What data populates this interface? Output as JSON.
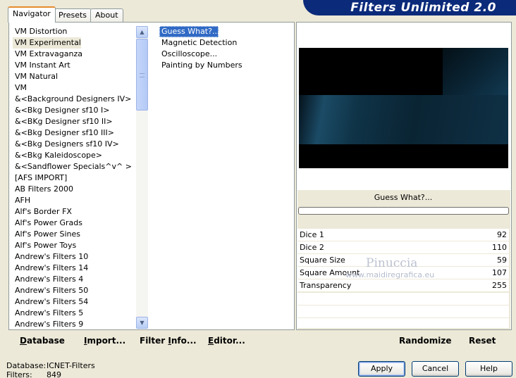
{
  "header": {
    "title": "Filters Unlimited 2.0"
  },
  "tabs": [
    {
      "label": "Navigator",
      "active": true
    },
    {
      "label": "Presets",
      "active": false
    },
    {
      "label": "About",
      "active": false
    }
  ],
  "categories": {
    "selected_index": 1,
    "items": [
      "VM Distortion",
      "VM Experimental",
      "VM Extravaganza",
      "VM Instant Art",
      "VM Natural",
      "VM",
      "&<Background Designers IV>",
      "&<Bkg Designer sf10 I>",
      "&<BKg Designer sf10 II>",
      "&<Bkg Designer sf10 III>",
      "&<Bkg Designers sf10 IV>",
      "&<Bkg Kaleidoscope>",
      "&<Sandflower Specials^v^ >",
      "[AFS IMPORT]",
      "AB Filters 2000",
      "AFH",
      "Alf's Border FX",
      "Alf's Power Grads",
      "Alf's Power Sines",
      "Alf's Power Toys",
      "Andrew's Filters 10",
      "Andrew's Filters 14",
      "Andrew's Filters 4",
      "Andrew's Filters 50",
      "Andrew's Filters 54",
      "Andrew's Filters 5",
      "Andrew's Filters 9"
    ]
  },
  "filters": {
    "selected_index": 0,
    "items": [
      "Guess What?...",
      "Magnetic Detection",
      "Oscilloscope...",
      "Painting by Numbers"
    ]
  },
  "preview": {
    "filter_name": "Guess What?...",
    "progress": 0
  },
  "params": [
    {
      "label": "Dice 1",
      "value": "92"
    },
    {
      "label": "Dice 2",
      "value": "110"
    },
    {
      "label": "Square Size",
      "value": "59"
    },
    {
      "label": "Square Amount",
      "value": "107"
    },
    {
      "label": "Transparency",
      "value": "255"
    }
  ],
  "watermark": {
    "name": "Pinuccia",
    "site": "www.maidiregrafica.eu"
  },
  "toolbar": {
    "database": {
      "u": "D",
      "rest": "atabase"
    },
    "import": {
      "u": "I",
      "rest": "mport..."
    },
    "filter_info": {
      "pre": "Filter ",
      "u": "I",
      "rest": "nfo..."
    },
    "editor": {
      "u": "E",
      "rest": "ditor..."
    },
    "randomize": "Randomize",
    "reset": "Reset"
  },
  "status": {
    "database_label": "Database:",
    "database_value": "ICNET-Filters",
    "filters_label": "Filters:",
    "filters_value": "849"
  },
  "buttons": {
    "apply": "Apply",
    "cancel": "Cancel",
    "help": "Help"
  }
}
